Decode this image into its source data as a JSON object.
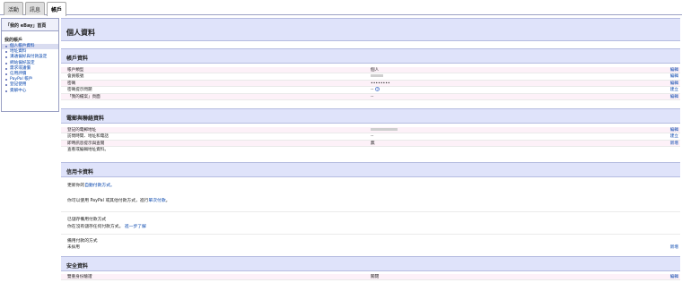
{
  "tabs": [
    "活動",
    "訊息",
    "帳戶"
  ],
  "sidebar": {
    "title": "「我的 eBay」首頁",
    "section": "我的帳戶",
    "items": [
      "個人帳戶資料",
      "地址資料",
      "溝通偏好與付款設定",
      "網站偏好設定",
      "需求或議價",
      "信用評價",
      "PayPal 帳戶",
      "登記使用",
      "資解中心"
    ]
  },
  "page_title": "個人資料",
  "account": {
    "title": "帳戶資料",
    "rows": [
      {
        "label": "帳戶類型",
        "value": "個人",
        "action": "編輯"
      },
      {
        "label": "會員帳號",
        "value": "",
        "action": "編輯"
      },
      {
        "label": "密碼",
        "value": "••••••••",
        "action": "編輯"
      },
      {
        "label": "密碼提示問題",
        "value": "--",
        "action": "建立"
      },
      {
        "label": "「我的檔案」頁面",
        "value": "--",
        "action": "編輯"
      }
    ]
  },
  "contact": {
    "title": "電郵與聯絡資料",
    "rows": [
      {
        "label": "登記的電郵地址",
        "value": "",
        "action": "編輯"
      },
      {
        "label": "訪問時間、地址和電話",
        "value": "--",
        "action": "建立"
      },
      {
        "label": "即時訊息提示與查閱",
        "value": "無",
        "action": "新增"
      }
    ],
    "view_link": "查看或編輯地址資料。"
  },
  "credit": {
    "title": "信用卡資料",
    "line1_prefix": "更新你的",
    "line1_link": "自動付款方式。",
    "line2_prefix": "你可以使用 PayPal 或其他付款方式，進行",
    "line2_link": "單次付款",
    "line2_suffix": "。",
    "auto_pay_label": "已儲存備用付款方式",
    "auto_pay_text": "你在沒有儲存任何付款方式。",
    "auto_pay_link": "進一步了解",
    "backup_label": "備用付款的方式",
    "backup_value": "未採用",
    "backup_action": "新增"
  },
  "security": {
    "title": "安全資料",
    "row": {
      "label": "雙重身份驗證",
      "value": "關閉",
      "action": "編輯"
    }
  }
}
